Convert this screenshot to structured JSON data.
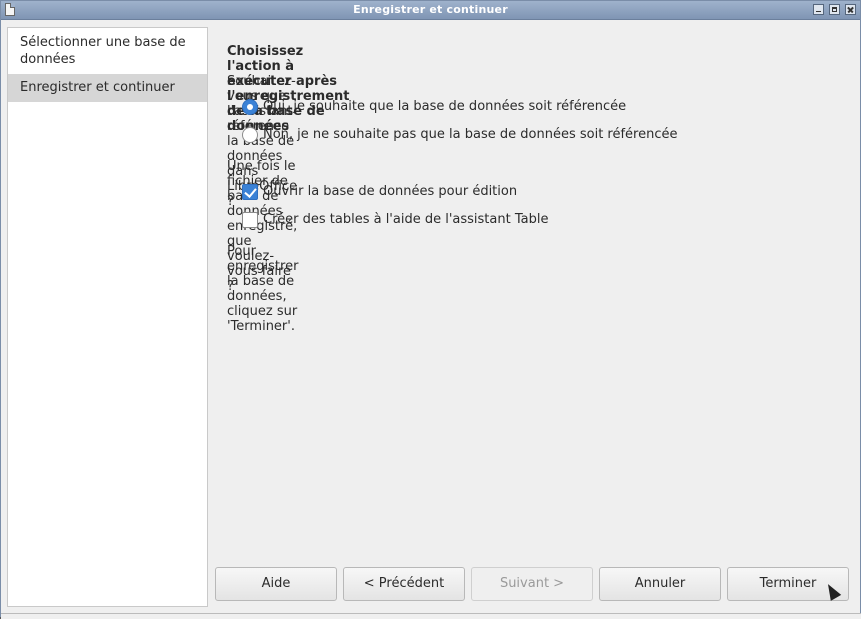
{
  "window": {
    "title": "Enregistrer et continuer"
  },
  "sidebar": {
    "items": [
      {
        "label": "Sélectionner une base de données"
      },
      {
        "label": "Enregistrer et continuer"
      }
    ]
  },
  "main": {
    "heading": "Choisissez l'action à exécuter après l'enregistrement de la base de données",
    "question1": "Souhaitez-vous que l'assistant référence la base de données dans LibreOffice ?",
    "radio_yes": "Oui, je souhaite que la base de données soit référencée",
    "radio_no": "Non, je ne souhaite pas que la base de données soit référencée",
    "question2": "Une fois le fichier de base de données enregistré, que voulez-vous faire ?",
    "check_open": "Ouvrir la base de données pour édition",
    "check_tables": "Créer des tables à l'aide de l'assistant Table",
    "finish_note": "Pour enregistrer la base de données, cliquez sur 'Terminer'."
  },
  "buttons": {
    "help": "Aide",
    "back": "< Précédent",
    "next": "Suivant >",
    "cancel": "Annuler",
    "finish": "Terminer"
  },
  "colors": {
    "accent": "#3b82d6",
    "titlebar": "#8ea3c0"
  }
}
